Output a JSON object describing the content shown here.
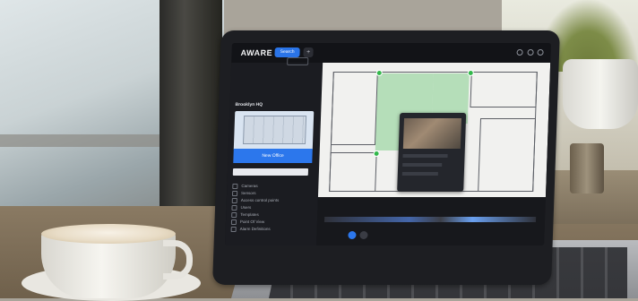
{
  "app": {
    "brand": "AWARE",
    "nav_pill": "Search",
    "nav_more": "+"
  },
  "sidebar": {
    "site_label": "Brooklyn HQ",
    "new_button": "New Office",
    "menu_items": [
      "Cameras",
      "Sensors",
      "Access control points",
      "Users",
      "Templates",
      "Point Of View",
      "Alarm Definitions"
    ]
  },
  "colors": {
    "accent": "#2c77ec",
    "zone": "#84cd8c",
    "sidebar_bg": "#1b1c21"
  }
}
